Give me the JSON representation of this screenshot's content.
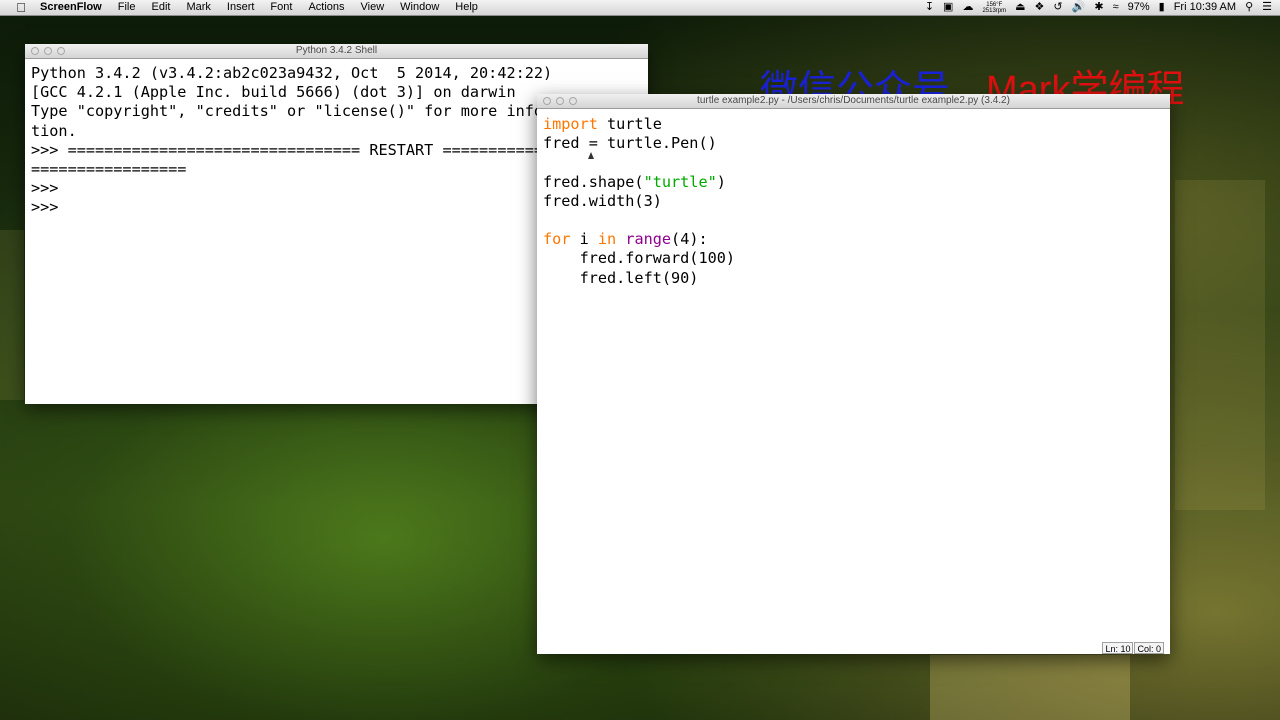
{
  "menubar": {
    "app_name": "ScreenFlow",
    "items": [
      "File",
      "Edit",
      "Mark",
      "Insert",
      "Font",
      "Actions",
      "View",
      "Window",
      "Help"
    ],
    "temp_line1": "156°F",
    "temp_line2": "2513rpm",
    "battery": "97%",
    "clock": "Fri 10:39 AM"
  },
  "shell": {
    "title": "Python 3.4.2 Shell",
    "lines": [
      "Python 3.4.2 (v3.4.2:ab2c023a9432, Oct  5 2014, 20:42:22)",
      "[GCC 4.2.1 (Apple Inc. build 5666) (dot 3)] on darwin",
      "Type \"copyright\", \"credits\" or \"license()\" for more informa",
      "tion.",
      ">>> ================================ RESTART ================",
      "=================",
      ">>>",
      ">>>"
    ]
  },
  "editor": {
    "title": "turtle example2.py - /Users/chris/Documents/turtle example2.py (3.4.2)",
    "code": {
      "l1_kw": "import",
      "l1_rest": " turtle",
      "l2": "fred = turtle.Pen()",
      "l4_a": "fred.shape(",
      "l4_str": "\"turtle\"",
      "l4_b": ")",
      "l5": "fred.width(3)",
      "l7_for": "for",
      "l7_mid1": " i ",
      "l7_in": "in",
      "l7_sp": " ",
      "l7_range": "range",
      "l7_end": "(4):",
      "l8": "    fred.forward(100)",
      "l9": "    fred.left(90)"
    },
    "status_ln": "Ln: 10",
    "status_col": "Col: 0"
  },
  "watermark": {
    "part1": "微信公众号",
    "part2": "Mark学编程"
  },
  "colors": {
    "keyword": "#ff7700",
    "builtin": "#900090",
    "string": "#00aa00",
    "watermark_blue": "#1a22d8",
    "watermark_red": "#e01010"
  }
}
